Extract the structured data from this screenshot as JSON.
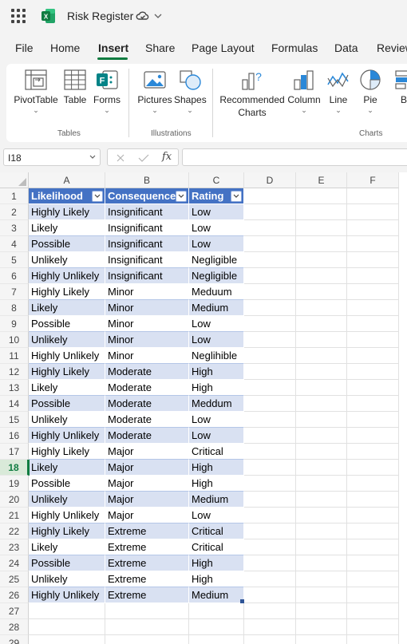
{
  "app": {
    "title": "Risk Register",
    "brand_color": "#107c41"
  },
  "menu": {
    "items": [
      {
        "label": "File",
        "active": false
      },
      {
        "label": "Home",
        "active": false
      },
      {
        "label": "Insert",
        "active": true
      },
      {
        "label": "Share",
        "active": false
      },
      {
        "label": "Page Layout",
        "active": false
      },
      {
        "label": "Formulas",
        "active": false
      },
      {
        "label": "Data",
        "active": false
      },
      {
        "label": "Review",
        "active": false
      }
    ]
  },
  "ribbon": {
    "groups": [
      {
        "label": "Tables"
      },
      {
        "label": "Illustrations"
      },
      {
        "label": "Charts"
      }
    ],
    "buttons": [
      {
        "label": "PivotTable",
        "icon": "pivottable-icon"
      },
      {
        "label": "Table",
        "icon": "table-icon"
      },
      {
        "label": "Forms",
        "icon": "forms-icon"
      },
      {
        "label": "Pictures",
        "icon": "pictures-icon"
      },
      {
        "label": "Shapes",
        "icon": "shapes-icon"
      },
      {
        "label": "Recommended Charts",
        "line1": "Recommended",
        "line2": "Charts",
        "icon": "recommended-charts-icon"
      },
      {
        "label": "Column",
        "icon": "column-chart-icon"
      },
      {
        "label": "Line",
        "icon": "line-chart-icon"
      },
      {
        "label": "Pie",
        "icon": "pie-chart-icon"
      },
      {
        "label": "Bar",
        "icon": "bar-chart-icon"
      }
    ]
  },
  "formula_bar": {
    "name_box": "I18",
    "fx_label": "fx",
    "formula": ""
  },
  "sheet": {
    "columns": [
      "A",
      "B",
      "C",
      "D",
      "E",
      "F"
    ],
    "selected_row": "18",
    "table_header": [
      "Likelihood",
      "Consequence",
      "Rating"
    ],
    "rows": [
      [
        "Highly Likely",
        "Insignificant",
        "Low"
      ],
      [
        "Likely",
        "Insignificant",
        "Low"
      ],
      [
        "Possible",
        "Insignificant",
        "Low"
      ],
      [
        "Unlikely",
        "Insignificant",
        "Negligible"
      ],
      [
        "Highly Unlikely",
        "Insignificant",
        "Negligible"
      ],
      [
        "Highly Likely",
        "Minor",
        "Meduum"
      ],
      [
        "Likely",
        "Minor",
        "Medium"
      ],
      [
        "Possible",
        "Minor",
        "Low"
      ],
      [
        "Unlikely",
        "Minor",
        "Low"
      ],
      [
        "Highly Unlikely",
        "Minor",
        "Neglihible"
      ],
      [
        "Highly Likely",
        "Moderate",
        "High"
      ],
      [
        "Likely",
        "Moderate",
        "High"
      ],
      [
        "Possible",
        "Moderate",
        "Meddum"
      ],
      [
        "Unlikely",
        "Moderate",
        "Low"
      ],
      [
        "Highly Unlikely",
        "Moderate",
        "Low"
      ],
      [
        "Highly Likely",
        "Major",
        "Critical"
      ],
      [
        "Likely",
        "Major",
        "High"
      ],
      [
        "Possible",
        "Major",
        "High"
      ],
      [
        "Unlikely",
        "Major",
        "Medium"
      ],
      [
        "Highly Unlikely",
        "Major",
        "Low"
      ],
      [
        "Highly Likely",
        "Extreme",
        "Critical"
      ],
      [
        "Likely",
        "Extreme",
        "Critical"
      ],
      [
        "Possible",
        "Extreme",
        "High"
      ],
      [
        "Unlikely",
        "Extreme",
        "High"
      ],
      [
        "Highly Unlikely",
        "Extreme",
        "Medium"
      ]
    ],
    "row_numbers": [
      "1",
      "2",
      "3",
      "4",
      "5",
      "6",
      "7",
      "8",
      "9",
      "10",
      "11",
      "12",
      "13",
      "14",
      "15",
      "16",
      "17",
      "18",
      "19",
      "20",
      "21",
      "22",
      "23",
      "24",
      "25",
      "26",
      "27",
      "28",
      "29"
    ],
    "header_color": "#4472c4",
    "band_color": "#d9e1f2"
  }
}
